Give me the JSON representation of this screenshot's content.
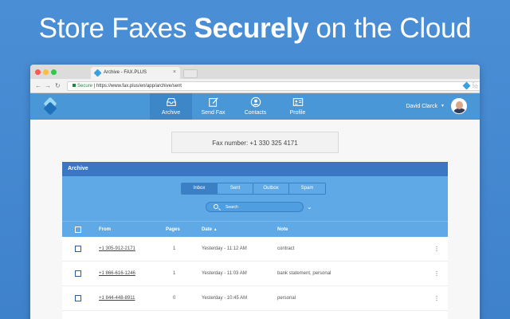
{
  "headline": {
    "normal1": "Store Faxes ",
    "bold": "Securely",
    "normal2": " on the Cloud"
  },
  "browser": {
    "tab_title": "Archive - FAX.PLUS",
    "url_secure": "Secure",
    "url": "https://www.fax.plus/en/app/archive/sent"
  },
  "nav": {
    "items": [
      {
        "label": "Archive",
        "icon": "inbox-icon",
        "active": true
      },
      {
        "label": "Send Fax",
        "icon": "edit-icon",
        "active": false
      },
      {
        "label": "Contacts",
        "icon": "user-icon",
        "active": false
      },
      {
        "label": "Profile",
        "icon": "id-card-icon",
        "active": false
      }
    ],
    "user_name": "David Clarck"
  },
  "fax_number": "Fax number: +1 330 325 4171",
  "archive": {
    "title": "Archive",
    "tabs": [
      "Inbox",
      "Sent",
      "Outbox",
      "Spam"
    ],
    "active_tab": "Inbox",
    "search_placeholder": "Search",
    "columns": {
      "from": "From",
      "pages": "Pages",
      "date": "Date",
      "note": "Note"
    },
    "rows": [
      {
        "from": "+1 305-912-2171",
        "pages": "1",
        "date": "Yesterday - 11:12 AM",
        "note": "contract"
      },
      {
        "from": "+1 866-616-1246",
        "pages": "1",
        "date": "Yesterday - 11:03 AM",
        "note": "bank statement, personal"
      },
      {
        "from": "+1 844-448-8911",
        "pages": "0",
        "date": "Yesterday - 10:45 AM",
        "note": "personal"
      }
    ]
  }
}
